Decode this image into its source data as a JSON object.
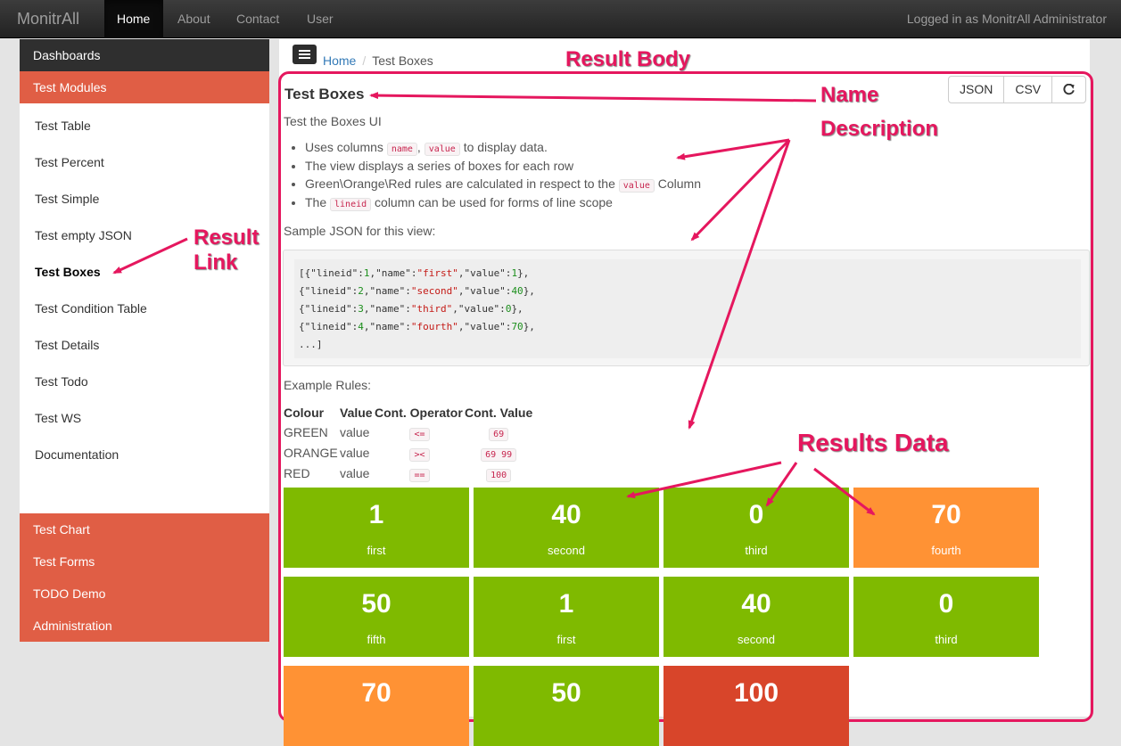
{
  "navbar": {
    "brand": "MonitrAll",
    "links": [
      "Home",
      "About",
      "Contact",
      "User"
    ],
    "login_text": "Logged in as MonitrAll Administrator"
  },
  "sidebar": {
    "dashboards": "Dashboards",
    "test_modules": "Test Modules",
    "items": [
      "Test Table",
      "Test Percent",
      "Test Simple",
      "Test empty JSON",
      "Test Boxes",
      "Test Condition Table",
      "Test Details",
      "Test Todo",
      "Test WS",
      "Documentation"
    ],
    "bottom": [
      "Test Chart",
      "Test Forms",
      "TODO Demo",
      "Administration"
    ]
  },
  "breadcrumb": {
    "home": "Home",
    "current": "Test Boxes"
  },
  "buttons": {
    "json": "JSON",
    "csv": "CSV"
  },
  "content": {
    "title": "Test Boxes",
    "description": "Test the Boxes UI",
    "bullet1_pre": "Uses columns",
    "code_name": "name",
    "bullet1_comma": ",",
    "code_value": "value",
    "bullet1_post": "to display data.",
    "bullet2": "The view displays a series of boxes for each row",
    "bullet3_pre": "Green\\Orange\\Red rules are calculated in respect to the",
    "bullet3_post": "Column",
    "bullet4_pre": "The",
    "code_lineid": "lineid",
    "bullet4_post": "column can be used for forms of line scope",
    "sample_label": "Sample JSON for this view:",
    "sample_rows": [
      {
        "prefix": "[{",
        "lineid": "1",
        "name": "\"first\"",
        "value": "1"
      },
      {
        "prefix": "{",
        "lineid": "2",
        "name": "\"second\"",
        "value": "40"
      },
      {
        "prefix": "{",
        "lineid": "3",
        "name": "\"third\"",
        "value": "0"
      },
      {
        "prefix": "{",
        "lineid": "4",
        "name": "\"fourth\"",
        "value": "70"
      }
    ],
    "sample_ellipsis": "...]",
    "rules_label": "Example Rules:",
    "rules_headers": [
      "Colour",
      "Value",
      "Cont. Operator",
      "Cont. Value"
    ],
    "rules": [
      {
        "colour": "GREEN",
        "value": "value",
        "op": "<=",
        "cont": "69"
      },
      {
        "colour": "ORANGE",
        "value": "value",
        "op": "><",
        "cont": "69 99"
      },
      {
        "colour": "RED",
        "value": "value",
        "op": "==",
        "cont": "100"
      }
    ]
  },
  "boxes": [
    {
      "value": "1",
      "name": "first",
      "color": "green"
    },
    {
      "value": "40",
      "name": "second",
      "color": "green"
    },
    {
      "value": "0",
      "name": "third",
      "color": "green"
    },
    {
      "value": "70",
      "name": "fourth",
      "color": "orange"
    },
    {
      "value": "50",
      "name": "fifth",
      "color": "green"
    },
    {
      "value": "1",
      "name": "first",
      "color": "green"
    },
    {
      "value": "40",
      "name": "second",
      "color": "green"
    },
    {
      "value": "0",
      "name": "third",
      "color": "green"
    },
    {
      "value": "70",
      "name": "",
      "color": "orange"
    },
    {
      "value": "50",
      "name": "",
      "color": "green"
    },
    {
      "value": "100",
      "name": "",
      "color": "red"
    }
  ],
  "colors": {
    "green": "#7fba00",
    "orange": "#ff9234",
    "red": "#d8452a",
    "annotation": "#e5175e",
    "sidebar_accent": "#e05e45"
  },
  "annotations": {
    "result_body": "Result Body",
    "name": "Name",
    "description": "Description",
    "result_link_1": "Result",
    "result_link_2": "Link",
    "results_data": "Results Data"
  },
  "icons": {
    "menu": "hamburger-icon",
    "refresh": "refresh-icon"
  }
}
